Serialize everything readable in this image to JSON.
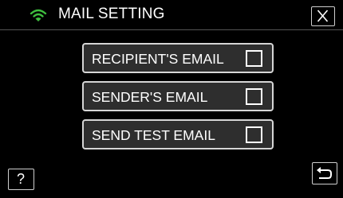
{
  "header": {
    "title": "MAIL SETTING",
    "wifi_icon": "wifi-icon",
    "close_icon": "close-icon"
  },
  "menu": {
    "items": [
      {
        "label": "RECIPIENT'S EMAIL",
        "checked": false
      },
      {
        "label": "SENDER'S EMAIL",
        "checked": false
      },
      {
        "label": "SEND TEST EMAIL",
        "checked": false
      }
    ]
  },
  "footer": {
    "help_label": "?",
    "back_icon": "return-arrow-icon"
  },
  "colors": {
    "background": "#000000",
    "button_fill": "#2e2e2e",
    "button_border": "#d6d6d6",
    "wifi_green": "#3fbf3f",
    "text": "#ffffff"
  }
}
